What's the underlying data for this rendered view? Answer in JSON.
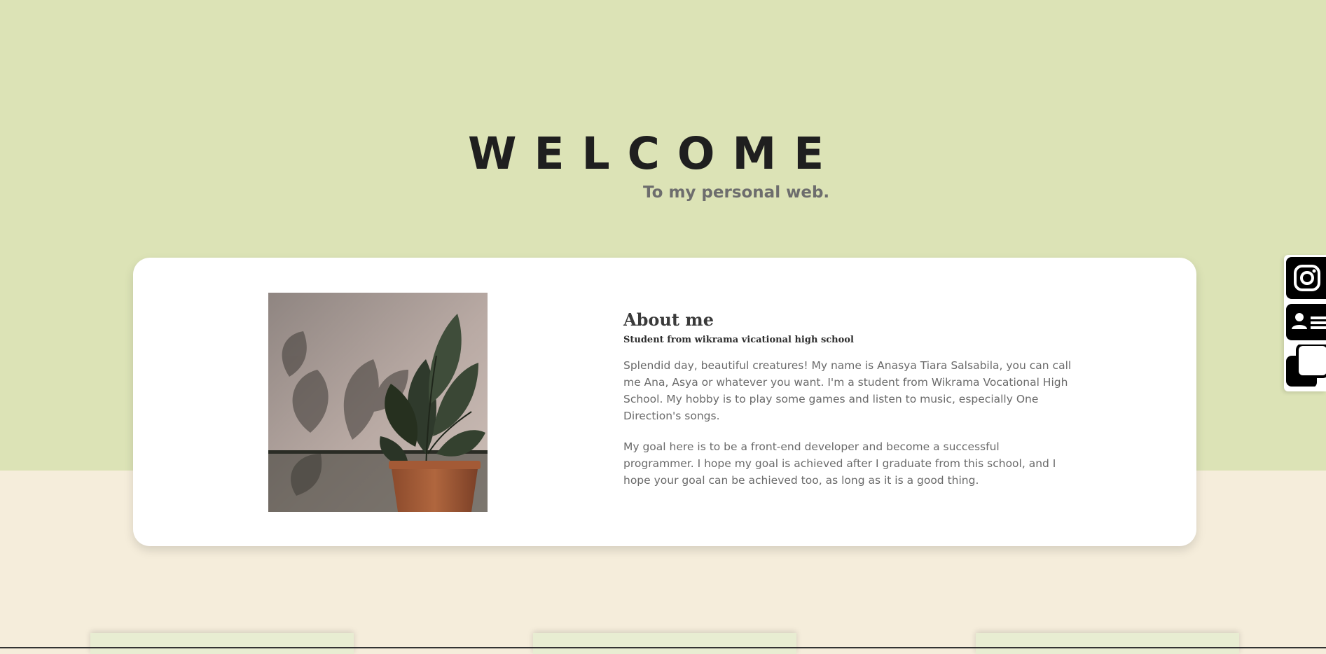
{
  "hero": {
    "title": "WELCOME",
    "subtitle": "To my personal web."
  },
  "about": {
    "heading": "About me",
    "subheading": "Student from wikrama vicational high school",
    "paragraphs": [
      "Splendid day, beautiful creatures! My name is Anasya Tiara Salsabila, you can call me Ana, Asya or whatever you want. I'm a student from Wikrama Vocational High School. My hobby is to play some games and listen to music, especially One Direction's songs.",
      "My goal here is to be a front-end developer and become a successful programmer. I hope my goal is achieved after I graduate from this school, and I hope your goal can be achieved too, as long as it is a good thing."
    ],
    "photo_icon": "plant-photo"
  },
  "social": {
    "items": [
      {
        "icon": "instagram-icon"
      },
      {
        "icon": "contact-card-icon"
      },
      {
        "icon": "pages-icon"
      }
    ]
  },
  "colors": {
    "hero_bg": "#DCE3B6",
    "page_bg": "#F5EDDB",
    "card_bg": "#FFFFFF",
    "title_text": "#1F1F1F",
    "subtitle_text": "#6D6D6D",
    "body_text": "#6A6A6A"
  }
}
